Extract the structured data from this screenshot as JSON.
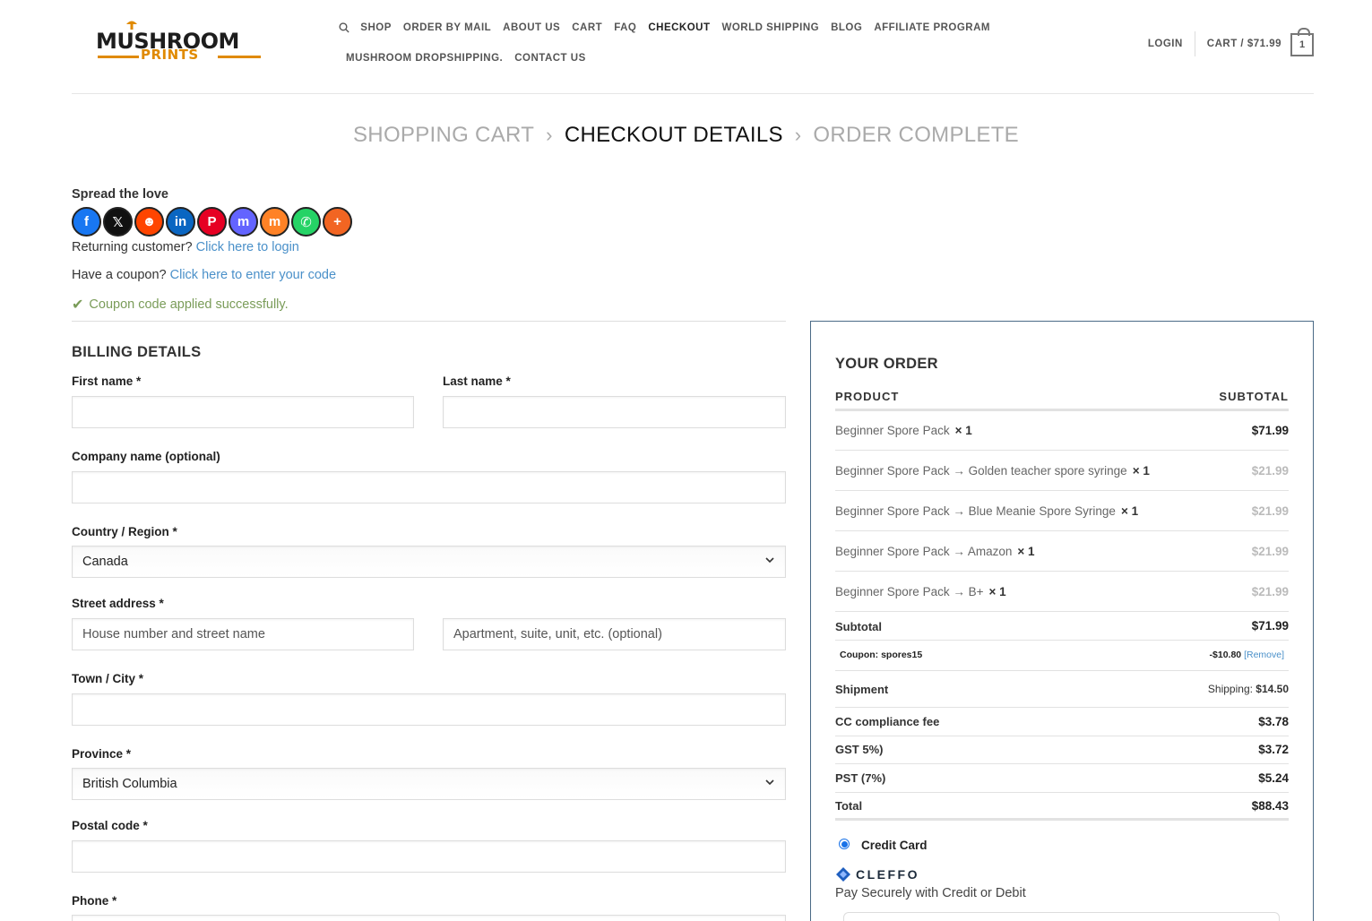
{
  "brand": {
    "line1": "MUSHROOM",
    "line2": "PRINTS",
    "accent": "#e08a00"
  },
  "nav": {
    "row1": [
      "SHOP",
      "ORDER BY MAIL",
      "ABOUT US",
      "CART",
      "FAQ",
      "CHECKOUT",
      "WORLD SHIPPING",
      "BLOG",
      "AFFILIATE PROGRAM"
    ],
    "row2": [
      "MUSHROOM DROPSHIPPING.",
      "CONTACT US"
    ],
    "active": "CHECKOUT"
  },
  "header_right": {
    "login": "LOGIN",
    "cart": "CART / $71.99",
    "cart_count": "1"
  },
  "steps": [
    "SHOPPING CART",
    "CHECKOUT DETAILS",
    "ORDER COMPLETE"
  ],
  "steps_sep": "›",
  "share": {
    "title": "Spread the love",
    "buttons": [
      {
        "name": "facebook",
        "color": "#1877f2",
        "glyph": "f"
      },
      {
        "name": "x",
        "color": "#111111",
        "glyph": "𝕏"
      },
      {
        "name": "reddit",
        "color": "#ff4500",
        "glyph": "☻"
      },
      {
        "name": "linkedin",
        "color": "#0a66c2",
        "glyph": "in"
      },
      {
        "name": "pinterest",
        "color": "#e60023",
        "glyph": "P"
      },
      {
        "name": "mastodon",
        "color": "#6364ff",
        "glyph": "m"
      },
      {
        "name": "mix",
        "color": "#ff8226",
        "glyph": "m"
      },
      {
        "name": "whatsapp",
        "color": "#25d366",
        "glyph": "✆"
      },
      {
        "name": "more",
        "color": "#f26522",
        "glyph": "+"
      }
    ]
  },
  "notices": {
    "returning": "Returning customer?",
    "returning_link": "Click here to login",
    "coupon": "Have a coupon?",
    "coupon_link": "Click here to enter your code",
    "coupon_ok": "Coupon code applied successfully.",
    "success_color": "#7a9c59",
    "link_color": "#4a90c9"
  },
  "billing": {
    "title": "BILLING DETAILS",
    "first_name": "First name *",
    "last_name": "Last name *",
    "company": "Company name (optional)",
    "country": "Country / Region *",
    "country_value": "Canada",
    "street": "Street address *",
    "street_ph1": "House number and street name",
    "street_ph2": "Apartment, suite, unit, etc. (optional)",
    "city": "Town / City *",
    "province": "Province *",
    "province_value": "British Columbia",
    "postal": "Postal code *",
    "phone": "Phone *"
  },
  "order": {
    "title": "YOUR ORDER",
    "col_product": "PRODUCT",
    "col_subtotal": "SUBTOTAL",
    "items": [
      {
        "name": "Beginner Spore Pack",
        "qty": "× 1",
        "price": "$71.99"
      },
      {
        "name": "Beginner Spore Pack → Golden teacher spore syringe",
        "qty": "× 1",
        "price": "$21.99"
      },
      {
        "name": "Beginner Spore Pack → Blue Meanie Spore Syringe",
        "qty": "× 1",
        "price": "$21.99"
      },
      {
        "name": "Beginner Spore Pack → Amazon",
        "qty": "× 1",
        "price": "$21.99"
      },
      {
        "name": "Beginner Spore Pack → B+",
        "qty": "× 1",
        "price": "$21.99"
      }
    ],
    "subtotal_label": "Subtotal",
    "subtotal": "$71.99",
    "coupon_label": "Coupon: spores15",
    "coupon_value": "-$10.80",
    "coupon_remove": "[Remove]",
    "shipment_label": "Shipment",
    "shipment_prefix": "Shipping:",
    "shipment_value": "$14.50",
    "fee_label": "CC compliance fee",
    "fee": "$3.78",
    "gst_label": "GST 5%)",
    "gst": "$3.72",
    "pst_label": "PST (7%)",
    "pst": "$5.24",
    "total_label": "Total",
    "total": "$88.43"
  },
  "payment": {
    "method": "Credit Card",
    "provider": "CLEFFO",
    "tagline": "Pay Securely with Credit or Debit"
  }
}
